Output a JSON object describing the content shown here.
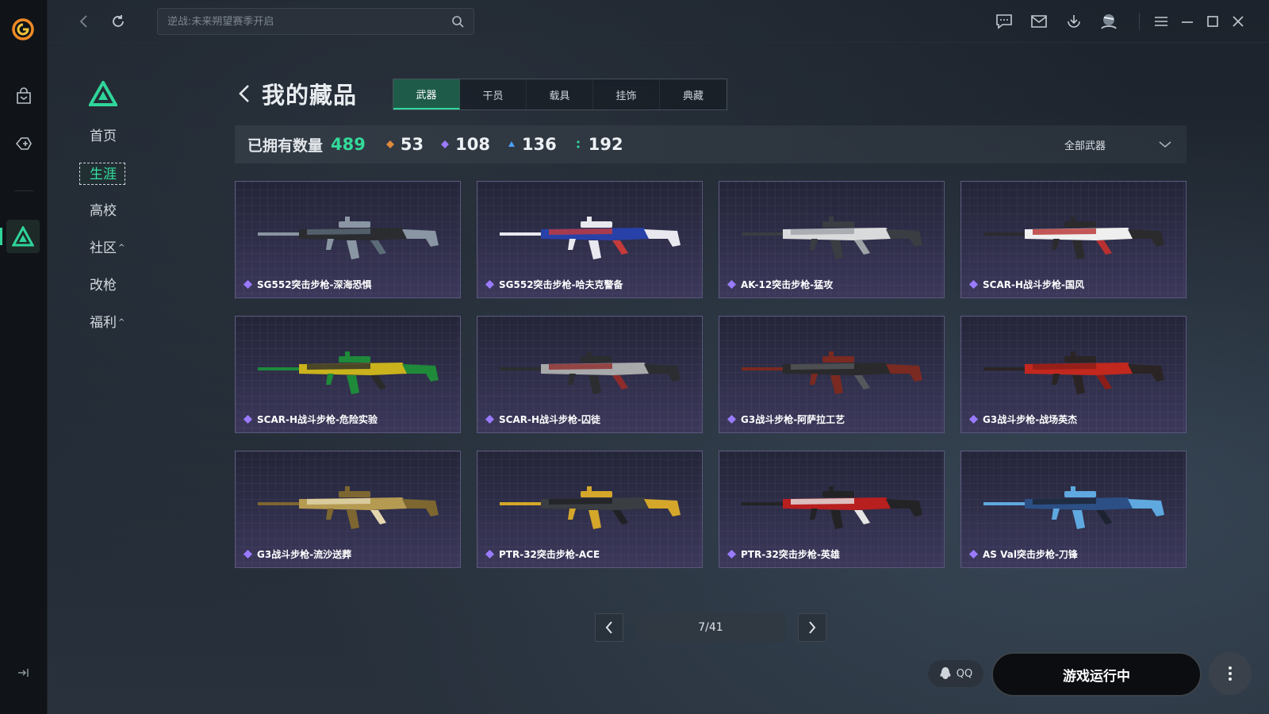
{
  "colors": {
    "accent": "#2fd59a",
    "card_border": "#5b587d",
    "rarity_orange": "#e08a3a",
    "rarity_purple": "#9a7bff",
    "rarity_blue": "#4aa3ff",
    "rarity_green": "#36d39a"
  },
  "topbar": {
    "search_placeholder": "逆战:未来朔望赛季开启",
    "icons": [
      "back-icon",
      "refresh-icon",
      "search-icon",
      "chat-icon",
      "mail-icon",
      "download-icon",
      "user-icon",
      "menu-icon",
      "minimize-icon",
      "maximize-icon",
      "close-icon"
    ]
  },
  "sidebar": {
    "items": [
      {
        "label": "首页",
        "caret": ""
      },
      {
        "label": "生涯",
        "caret": ""
      },
      {
        "label": "高校",
        "caret": ""
      },
      {
        "label": "社区",
        "caret": "^"
      },
      {
        "label": "改枪",
        "caret": ""
      },
      {
        "label": "福利",
        "caret": "^"
      }
    ]
  },
  "header": {
    "title": "我的藏品"
  },
  "tabs": [
    {
      "label": "武器",
      "active": true
    },
    {
      "label": "干员",
      "active": false
    },
    {
      "label": "载具",
      "active": false
    },
    {
      "label": "挂饰",
      "active": false
    },
    {
      "label": "典藏",
      "active": false
    }
  ],
  "stats": {
    "label": "已拥有数量",
    "total": "489",
    "rarities": [
      {
        "count": "53",
        "color": "#e08a3a"
      },
      {
        "count": "108",
        "color": "#9a7bff"
      },
      {
        "count": "136",
        "color": "#4aa3ff"
      },
      {
        "count": "192",
        "color": "#36d39a"
      }
    ],
    "filter_label": "全部武器"
  },
  "items": [
    {
      "name": "SG552突击步枪-深海恐惧",
      "palette": [
        "#2a2c30",
        "#8a96a3",
        "#5c6b78"
      ]
    },
    {
      "name": "SG552突击步枪-哈夫克警备",
      "palette": [
        "#2841a8",
        "#e8e8ee",
        "#c63a3a"
      ]
    },
    {
      "name": "AK-12突击步枪-猛攻",
      "palette": [
        "#d9dadc",
        "#3a3d42",
        "#9ea3a8"
      ]
    },
    {
      "name": "SCAR-H战斗步枪-国风",
      "palette": [
        "#efefef",
        "#2b2b2e",
        "#b83030"
      ]
    },
    {
      "name": "SCAR-H战斗步枪-危险实验",
      "palette": [
        "#c9b21c",
        "#1e8a3a",
        "#2a2a2a"
      ]
    },
    {
      "name": "SCAR-H战斗步枪-囚徒",
      "palette": [
        "#a7a9ab",
        "#2c2d30",
        "#8e2b2b"
      ]
    },
    {
      "name": "G3战斗步枪-阿萨拉工艺",
      "palette": [
        "#2a2a2c",
        "#7a2a20",
        "#55585c"
      ]
    },
    {
      "name": "G3战斗步枪-战场英杰",
      "palette": [
        "#c2281e",
        "#2a2424",
        "#8c1d18"
      ]
    },
    {
      "name": "G3战斗步枪-流沙送葬",
      "palette": [
        "#b59a52",
        "#7d6630",
        "#e4d7b0"
      ]
    },
    {
      "name": "PTR-32突击步枪-ACE",
      "palette": [
        "#3a3d42",
        "#d4a72a",
        "#1f2124"
      ]
    },
    {
      "name": "PTR-32突击步枪-英雄",
      "palette": [
        "#b81f1f",
        "#232326",
        "#e6e6e6"
      ]
    },
    {
      "name": "AS Val突击步枪-刀锋",
      "palette": [
        "#2c4f86",
        "#5fa8e0",
        "#1d2330"
      ]
    }
  ],
  "pagination": {
    "label": "7/41"
  },
  "footer": {
    "qq_label": "QQ",
    "run_label": "游戏运行中"
  }
}
